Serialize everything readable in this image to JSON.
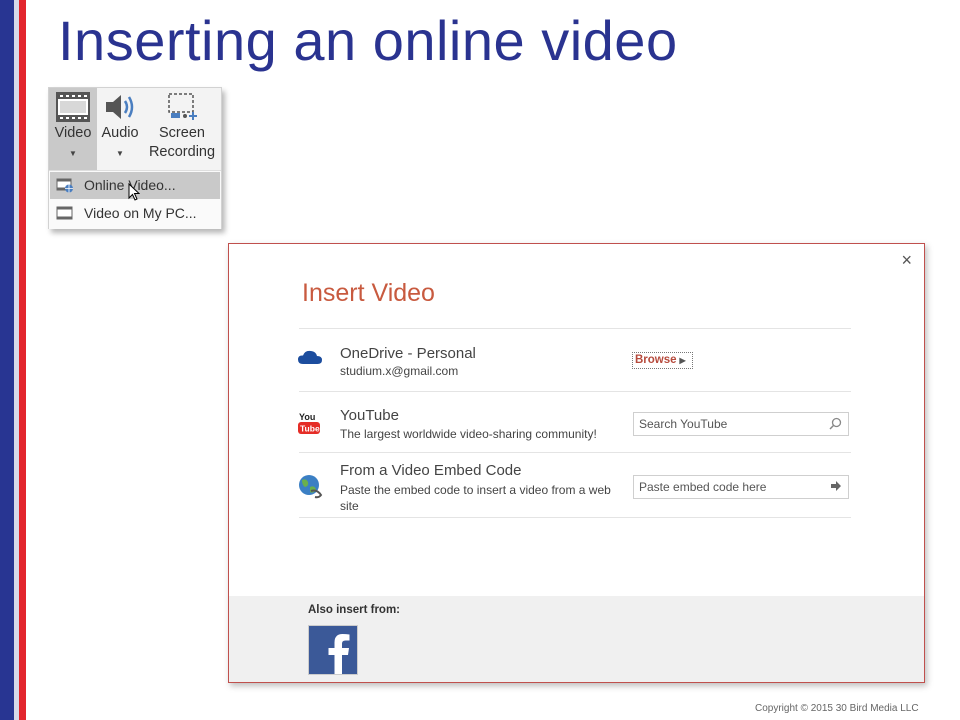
{
  "slide": {
    "title": "Inserting an online video",
    "copyright": "Copyright © 2015 30 Bird Media LLC"
  },
  "ribbon": {
    "buttons": [
      {
        "label": "Video",
        "icon": "film-icon",
        "has_dropdown": true
      },
      {
        "label": "Audio",
        "icon": "speaker-icon",
        "has_dropdown": true
      },
      {
        "label_line1": "Screen",
        "label_line2": "Recording",
        "icon": "screen-recording-icon"
      }
    ],
    "menu": [
      {
        "label": "Online Video...",
        "icon": "online-video-icon",
        "selected": true
      },
      {
        "label": "Video on My PC...",
        "icon": "film-icon",
        "selected": false
      }
    ]
  },
  "dialog": {
    "title": "Insert Video",
    "close_label": "×",
    "rows": [
      {
        "title": "OneDrive - Personal",
        "subtitle": "studium.x@gmail.com",
        "action_label": "Browse",
        "icon": "onedrive-cloud-icon"
      },
      {
        "title": "YouTube",
        "subtitle": "The largest worldwide video-sharing community!",
        "placeholder": "Search YouTube",
        "icon": "youtube-icon"
      },
      {
        "title": "From a Video Embed Code",
        "subtitle": "Paste the embed code to insert a video from a web site",
        "placeholder": "Paste embed code here",
        "icon": "globe-icon"
      }
    ],
    "also_insert_label": "Also insert from:",
    "also_insert_icon": "facebook-icon"
  },
  "colors": {
    "title_blue": "#2a3390",
    "bar_navy": "#283592",
    "bar_red": "#e3262d",
    "dialog_accent": "#c85a3f",
    "facebook_blue": "#3b5998"
  }
}
